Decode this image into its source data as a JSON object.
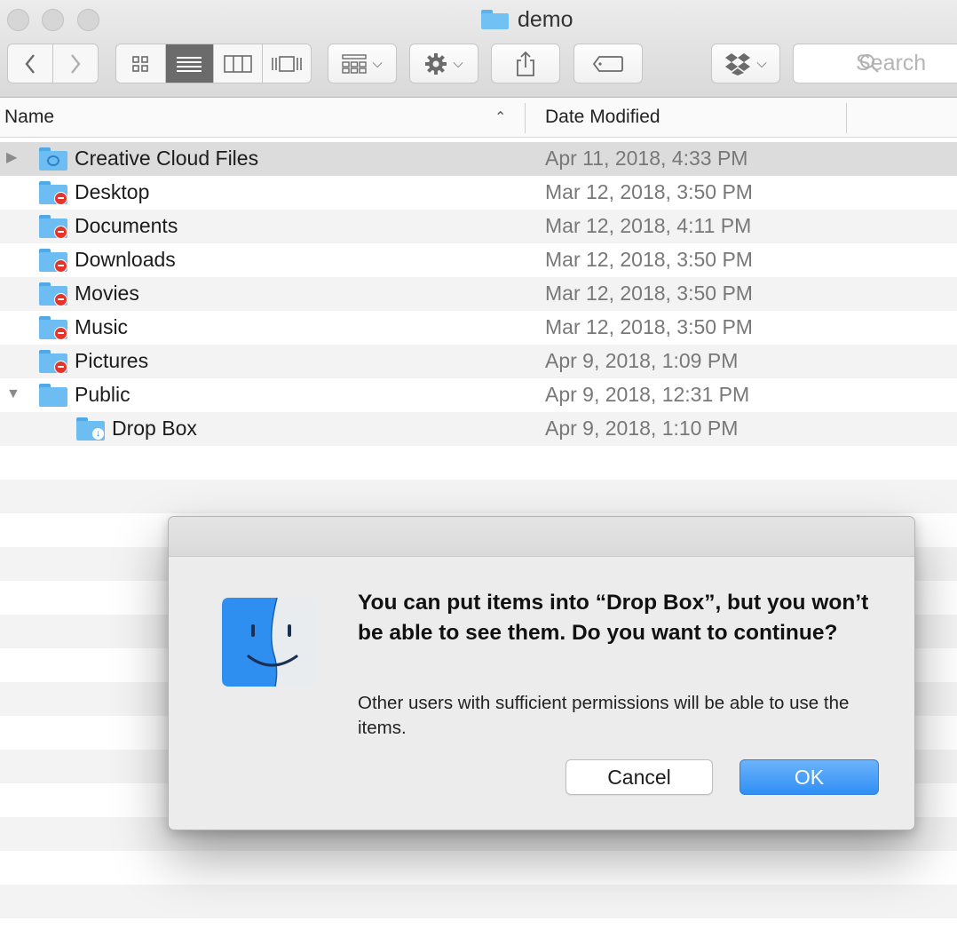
{
  "window": {
    "title": "demo",
    "folder_icon": "folder-icon"
  },
  "toolbar": {
    "back_icon": "chevron-left-icon",
    "forward_icon": "chevron-right-icon",
    "view_modes": [
      "icon-view-icon",
      "list-view-icon",
      "column-view-icon",
      "gallery-view-icon"
    ],
    "active_view": "list-view-icon",
    "group_icon": "group-icon",
    "action_icon": "gear-icon",
    "share_icon": "share-icon",
    "tag_icon": "tag-icon",
    "dropbox_icon": "dropbox-icon",
    "search_placeholder": "Search"
  },
  "columns": {
    "name": "Name",
    "date_modified": "Date Modified"
  },
  "files": [
    {
      "name": "Creative Cloud Files",
      "date": "Apr 11, 2018, 4:33 PM",
      "icon": "creative-cloud-folder-icon",
      "disclosure": "collapsed"
    },
    {
      "name": "Desktop",
      "date": "Mar 12, 2018, 3:50 PM",
      "icon": "restricted-folder-icon"
    },
    {
      "name": "Documents",
      "date": "Mar 12, 2018, 4:11 PM",
      "icon": "restricted-folder-icon"
    },
    {
      "name": "Downloads",
      "date": "Mar 12, 2018, 3:50 PM",
      "icon": "restricted-folder-icon"
    },
    {
      "name": "Movies",
      "date": "Mar 12, 2018, 3:50 PM",
      "icon": "restricted-folder-icon"
    },
    {
      "name": "Music",
      "date": "Mar 12, 2018, 3:50 PM",
      "icon": "restricted-folder-icon"
    },
    {
      "name": "Pictures",
      "date": "Apr 9, 2018, 1:09 PM",
      "icon": "restricted-folder-icon"
    },
    {
      "name": "Public",
      "date": "Apr 9, 2018, 12:31 PM",
      "icon": "folder-icon",
      "disclosure": "expanded"
    },
    {
      "name": "Drop Box",
      "date": "Apr 9, 2018, 1:10 PM",
      "icon": "drop-box-folder-icon"
    }
  ],
  "dialog": {
    "icon": "finder-icon",
    "title": "You can put items into “Drop Box”, but you won’t be able to see them. Do you want to continue?",
    "message": "Other users with sufficient permissions will be able to use the items.",
    "cancel_label": "Cancel",
    "ok_label": "OK",
    "ok_color": "#2f8ff5"
  }
}
